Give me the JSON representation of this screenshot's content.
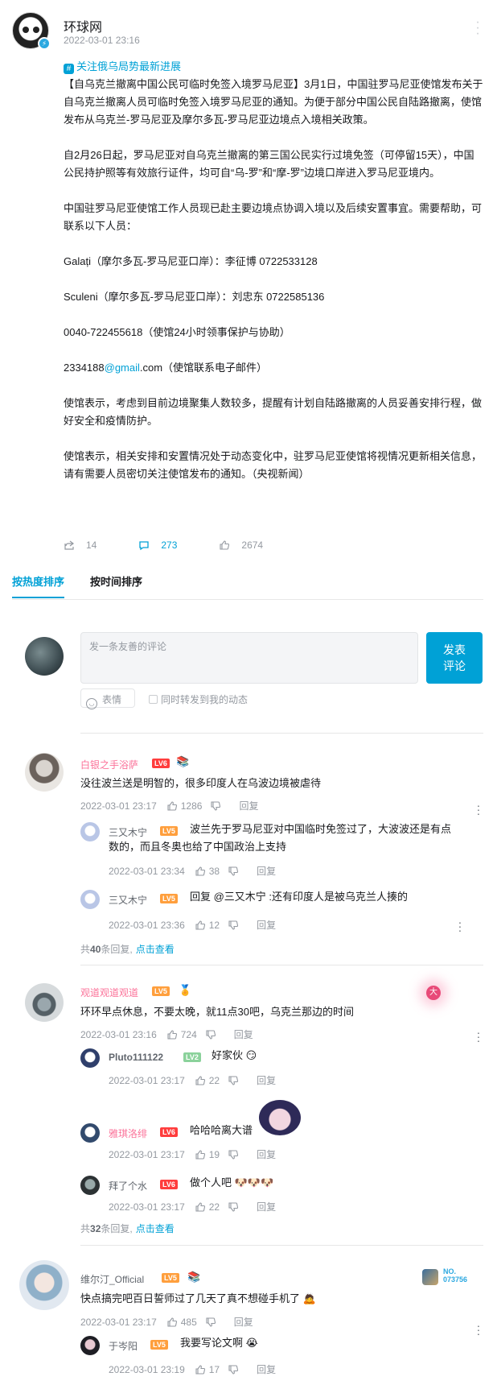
{
  "post": {
    "author": "环球网",
    "time": "2022-03-01 23:16",
    "topic": "关注俄乌局势最新进展",
    "paragraphs": [
      "【自乌克兰撤离中国公民可临时免签入境罗马尼亚】3月1日，中国驻罗马尼亚使馆发布关于自乌克兰撤离人员可临时免签入境罗马尼亚的通知。为便于部分中国公民自陆路撤离，使馆发布从乌克兰-罗马尼亚及摩尔多瓦-罗马尼亚边境点入境相关政策。",
      "自2月26日起，罗马尼亚对自乌克兰撤离的第三国公民实行过境免签（可停留15天），中国公民持护照等有效旅行证件，均可自“乌-罗”和“摩-罗”边境口岸进入罗马尼亚境内。",
      "中国驻罗马尼亚使馆工作人员现已赴主要边境点协调入境以及后续安置事宜。需要帮助，可联系以下人员：",
      "Galați（摩尔多瓦-罗马尼亚口岸）：李征博 0722533128",
      "Sculeni（摩尔多瓦-罗马尼亚口岸）：刘忠东 0722585136",
      "0040-722455618（使馆24小时领事保护与协助）",
      "使馆表示，考虑到目前边境聚集人数较多，提醒有计划自陆路撤离的人员妥善安排行程，做好安全和疫情防护。",
      "使馆表示，相关安排和安置情况处于动态变化中，驻罗马尼亚使馆将视情况更新相关信息，请有需要人员密切关注使馆发布的通知。（央视新闻）"
    ],
    "email_prefix": "2334188",
    "email_link": "@gmail",
    "email_suffix": ".com（使馆联系电子邮件）",
    "shares": "14",
    "comments": "273",
    "likes": "2674"
  },
  "tabs": [
    "按热度排序",
    "按时间排序"
  ],
  "composer": {
    "placeholder": "发一条友善的评论",
    "send_label_1": "发表",
    "send_label_2": "评论",
    "emoji_label": "表情",
    "forward_label": "同时转发到我的动态"
  },
  "threads": [
    {
      "user": "白银之手浴萨",
      "level": "LV6",
      "text": "没往波兰送是明智的，很多印度人在乌波边境被虐待",
      "time": "2022-03-01 23:17",
      "likes": "1286",
      "reply_label": "回复",
      "replies": [
        {
          "user": "三又木宁",
          "level": "LV5",
          "text1": "波兰先于罗马尼亚对中国临时免签过了，大波波还是有点",
          "text2": "数的，而且冬奥也给了中国政治上支持",
          "time": "2022-03-01 23:34",
          "likes": "38"
        },
        {
          "user": "三又木宁",
          "level": "LV5",
          "text1": "回复 @三又木宁 :还有印度人是被乌克兰人揍的",
          "time": "2022-03-01 23:36",
          "likes": "12"
        }
      ],
      "more_prefix": "共",
      "more_count": "40",
      "more_suffix": "条回复,",
      "more_link": "点击查看"
    },
    {
      "user": "观道观道观道",
      "level": "LV5",
      "text": "环环早点休息，不要太晚，就11点30吧，乌克兰那边的时间",
      "time": "2022-03-01 23:16",
      "likes": "724",
      "reply_label": "回复",
      "badge": "大",
      "replies": [
        {
          "user": "Pluto111122",
          "level": "LV2",
          "text1": "好家伙",
          "time": "2022-03-01 23:17",
          "likes": "22"
        },
        {
          "user": "雅琪洛绯",
          "level": "LV6",
          "text1": "哈哈哈离大谱",
          "time": "2022-03-01 23:17",
          "likes": "19"
        },
        {
          "user": "拜了个水",
          "level": "LV6",
          "text1": "做个人吧",
          "time": "2022-03-01 23:17",
          "likes": "22"
        }
      ],
      "more_prefix": "共",
      "more_count": "32",
      "more_suffix": "条回复,",
      "more_link": "点击查看"
    },
    {
      "user": "维尔汀_Official",
      "level": "LV5",
      "text": "快点搞完吧百日誓师过了几天了真不想碰手机了",
      "time": "2022-03-01 23:17",
      "likes": "485",
      "reply_label": "回复",
      "fan_no": "NO.",
      "fan_num": "073756",
      "replies": [
        {
          "user": "于岑阳",
          "level": "LV5",
          "text1": "我要写论文啊",
          "time": "2022-03-01 23:19",
          "likes": "17"
        }
      ]
    }
  ]
}
